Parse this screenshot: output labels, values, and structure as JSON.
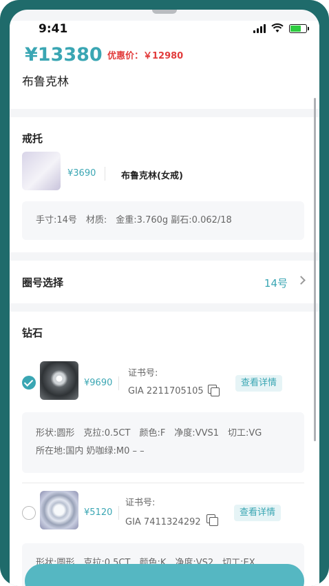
{
  "status": {
    "time": "9:41"
  },
  "price": {
    "main": "¥13380",
    "discount": "优惠价：￥12980"
  },
  "product": {
    "name": "布鲁克林"
  },
  "ring": {
    "section_title": "戒托",
    "price": "¥3690",
    "name": "布鲁克林(女戒)",
    "specs": "手寸:14号　材质:　金重:3.760g  副石:0.062/18"
  },
  "size": {
    "label": "圈号选择",
    "value": "14号"
  },
  "diamonds": {
    "section_title": "钻石",
    "items": [
      {
        "price": "¥9690",
        "cert_label": "证书号:",
        "cert_number": "GIA 2211705105",
        "detail_label": "查看详情",
        "specs_line1": "形状:圆形　克拉:0.5CT　颜色:F　净度:VVS1　切工:VG",
        "specs_line2": "所在地:国内  奶咖绿:M0 – –",
        "selected": true
      },
      {
        "price": "¥5120",
        "cert_label": "证书号:",
        "cert_number": "GIA 7411324292",
        "detail_label": "查看详情",
        "specs_line1": "形状:圆形　克拉:0.5CT　颜色:K　净度:VS2　切工:EX",
        "selected": false
      }
    ]
  },
  "colors": {
    "accent": "#3aa6b3",
    "discount": "#e23c3c",
    "frame": "#1f6b6b"
  }
}
